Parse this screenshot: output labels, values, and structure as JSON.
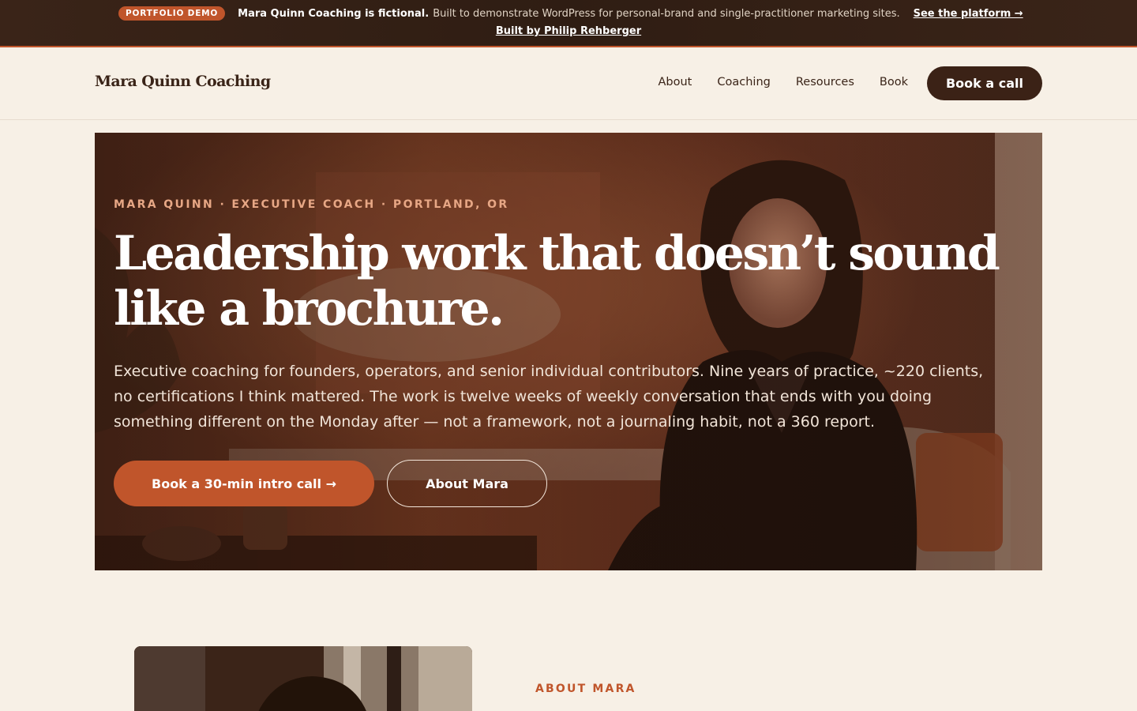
{
  "banner": {
    "pill": "PORTFOLIO DEMO",
    "strong_text": "Mara Quinn Coaching is fictional.",
    "text": "Built to demonstrate WordPress for personal-brand and single-practitioner marketing sites.",
    "platform_link": "See the platform →",
    "built_by_link": "Built by Philip Rehberger"
  },
  "header": {
    "logo": "Mara Quinn Coaching",
    "nav": [
      {
        "label": "About"
      },
      {
        "label": "Coaching"
      },
      {
        "label": "Resources"
      },
      {
        "label": "Book"
      }
    ],
    "cta": "Book a call"
  },
  "hero": {
    "eyebrow": "MARA QUINN · EXECUTIVE COACH · PORTLAND, OR",
    "headline": "Leadership work that doesn’t sound like a brochure.",
    "lede": "Executive coaching for founders, operators, and senior individual contributors. Nine years of practice, ~220 clients, no certifications I think mattered. The work is twelve weeks of weekly conversation that ends with you doing something different on the Monday after — not a framework, not a journaling habit, not a 360 report.",
    "primary_button": "Book a 30-min intro call →",
    "secondary_button": "About Mara"
  },
  "about": {
    "label": "ABOUT MARA"
  },
  "colors": {
    "accent": "#c0552b",
    "dark": "#3b2216",
    "background": "#f7f0e6"
  }
}
